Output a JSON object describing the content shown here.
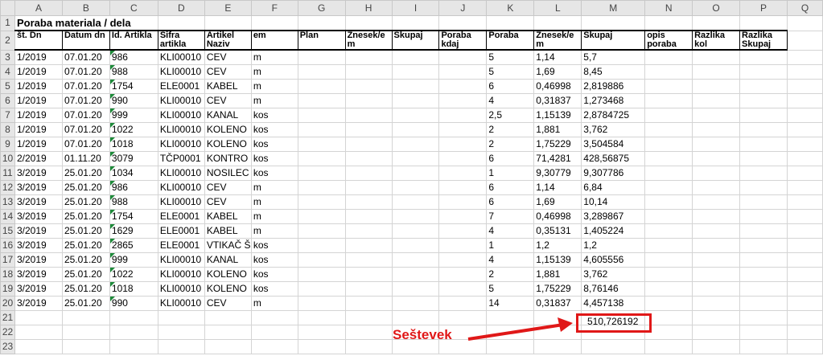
{
  "columns": [
    "A",
    "B",
    "C",
    "D",
    "E",
    "F",
    "G",
    "H",
    "I",
    "J",
    "K",
    "L",
    "M",
    "N",
    "O",
    "P",
    "Q"
  ],
  "title": "Poraba materiala / dela",
  "headers": [
    "št. Dn",
    "Datum dn",
    "Id. Artikla",
    "Šifra artikla",
    "Artikel Naziv",
    "em",
    "Plan",
    "Znesek/e m",
    "Skupaj",
    "Poraba kdaj",
    "Poraba",
    "Znesek/e m",
    "Skupaj",
    "opis poraba",
    "Razlika kol",
    "Razlika Skupaj"
  ],
  "rows": [
    [
      "1/2019",
      "07.01.20",
      "986",
      "KLI00010",
      "CEV",
      "m",
      "",
      "",
      "",
      "",
      "5",
      "1,14",
      "5,7"
    ],
    [
      "1/2019",
      "07.01.20",
      "988",
      "KLI00010",
      "CEV",
      "m",
      "",
      "",
      "",
      "",
      "5",
      "1,69",
      "8,45"
    ],
    [
      "1/2019",
      "07.01.20",
      "1754",
      "ELE0001",
      "KABEL",
      "m",
      "",
      "",
      "",
      "",
      "6",
      "0,46998",
      "2,819886"
    ],
    [
      "1/2019",
      "07.01.20",
      "990",
      "KLI00010",
      "CEV",
      "m",
      "",
      "",
      "",
      "",
      "4",
      "0,31837",
      "1,273468"
    ],
    [
      "1/2019",
      "07.01.20",
      "999",
      "KLI00010",
      "KANAL",
      "kos",
      "",
      "",
      "",
      "",
      "2,5",
      "1,15139",
      "2,8784725"
    ],
    [
      "1/2019",
      "07.01.20",
      "1022",
      "KLI00010",
      "KOLENO",
      "kos",
      "",
      "",
      "",
      "",
      "2",
      "1,881",
      "3,762"
    ],
    [
      "1/2019",
      "07.01.20",
      "1018",
      "KLI00010",
      "KOLENO",
      "kos",
      "",
      "",
      "",
      "",
      "2",
      "1,75229",
      "3,504584"
    ],
    [
      "2/2019",
      "01.11.20",
      "3079",
      "TČP0001",
      "KONTRO",
      "kos",
      "",
      "",
      "",
      "",
      "6",
      "71,4281",
      "428,56875"
    ],
    [
      "3/2019",
      "25.01.20",
      "1034",
      "KLI00010",
      "NOSILEC",
      "kos",
      "",
      "",
      "",
      "",
      "1",
      "9,30779",
      "9,307786"
    ],
    [
      "3/2019",
      "25.01.20",
      "986",
      "KLI00010",
      "CEV",
      "m",
      "",
      "",
      "",
      "",
      "6",
      "1,14",
      "6,84"
    ],
    [
      "3/2019",
      "25.01.20",
      "988",
      "KLI00010",
      "CEV",
      "m",
      "",
      "",
      "",
      "",
      "6",
      "1,69",
      "10,14"
    ],
    [
      "3/2019",
      "25.01.20",
      "1754",
      "ELE0001",
      "KABEL",
      "m",
      "",
      "",
      "",
      "",
      "7",
      "0,46998",
      "3,289867"
    ],
    [
      "3/2019",
      "25.01.20",
      "1629",
      "ELE0001",
      "KABEL",
      "m",
      "",
      "",
      "",
      "",
      "4",
      "0,35131",
      "1,405224"
    ],
    [
      "3/2019",
      "25.01.20",
      "2865",
      "ELE0001",
      "VTIKAČ Š",
      "kos",
      "",
      "",
      "",
      "",
      "1",
      "1,2",
      "1,2"
    ],
    [
      "3/2019",
      "25.01.20",
      "999",
      "KLI00010",
      "KANAL",
      "kos",
      "",
      "",
      "",
      "",
      "4",
      "1,15139",
      "4,605556"
    ],
    [
      "3/2019",
      "25.01.20",
      "1022",
      "KLI00010",
      "KOLENO",
      "kos",
      "",
      "",
      "",
      "",
      "2",
      "1,881",
      "3,762"
    ],
    [
      "3/2019",
      "25.01.20",
      "1018",
      "KLI00010",
      "KOLENO",
      "kos",
      "",
      "",
      "",
      "",
      "5",
      "1,75229",
      "8,76146"
    ],
    [
      "3/2019",
      "25.01.20",
      "990",
      "KLI00010",
      "CEV",
      "m",
      "",
      "",
      "",
      "",
      "14",
      "0,31837",
      "4,457138"
    ]
  ],
  "row_numbers": [
    "1",
    "2",
    "3",
    "4",
    "5",
    "6",
    "7",
    "8",
    "9",
    "10",
    "11",
    "12",
    "13",
    "14",
    "15",
    "16",
    "17",
    "18",
    "19",
    "20",
    "21",
    "22",
    "23"
  ],
  "sum_value": "510,726192",
  "annotation_label": "Seštevek",
  "colors": {
    "annotation": "#e01818",
    "indicator": "#1e8a3a",
    "header_bg": "#e6e6e6"
  }
}
